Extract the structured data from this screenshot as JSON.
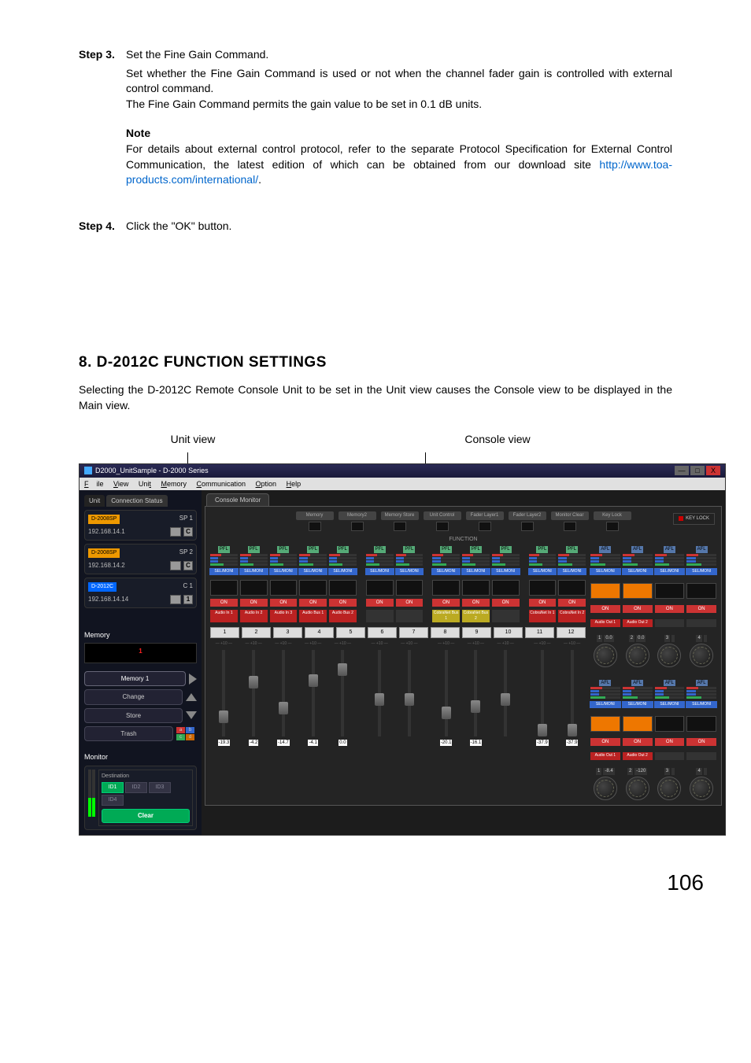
{
  "step3": {
    "label": "Step 3.",
    "headline": "Set the Fine Gain Command.",
    "body1": "Set whether the Fine Gain Command is used or not when the channel fader gain is controlled with external control command.",
    "body2": "The Fine Gain Command permits the gain value to be set in 0.1 dB units."
  },
  "note": {
    "label": "Note",
    "body_pre": "For details about external control protocol, refer to the separate Protocol Specification for External Control Communication, the latest edition of which can be obtained from our download site ",
    "link": "http://www.toa-products.com/international/",
    "body_post": "."
  },
  "step4": {
    "label": "Step 4.",
    "headline": "Click the \"OK\" button."
  },
  "section": {
    "heading": "8. D-2012C FUNCTION SETTINGS",
    "intro": "Selecting the D-2012C Remote Console Unit to be set in the Unit view causes the Console view to be displayed in the Main view.",
    "unit_view": "Unit view",
    "console_view": "Console view"
  },
  "app": {
    "title": "D2000_UnitSample - D-2000 Series",
    "menu": {
      "file": "File",
      "view": "View",
      "unit": "Unit",
      "memory": "Memory",
      "communication": "Communication",
      "option": "Option",
      "help": "Help"
    },
    "win": {
      "min": "—",
      "max": "□",
      "close": "X"
    },
    "left": {
      "tab_unit": "Unit",
      "tab_conn": "Connection Status",
      "units": [
        {
          "id": "D-2008SP",
          "idclass": "o",
          "sp": "SP 1",
          "ip": "192.168.14.1",
          "c": "C"
        },
        {
          "id": "D-2008SP",
          "idclass": "o",
          "sp": "SP 2",
          "ip": "192.168.14.2",
          "c": "C"
        },
        {
          "id": "D-2012C",
          "idclass": "b",
          "sp": "C 1",
          "ip": "192.168.14.14",
          "c": "1"
        }
      ],
      "mem_label": "Memory",
      "mem_num": "1",
      "mem_name": "Memory 1",
      "change": "Change",
      "store": "Store",
      "trash": "Trash",
      "tbtns": [
        "a",
        "b",
        "c",
        "d"
      ],
      "mon_label": "Monitor",
      "dest_label": "Destination",
      "ids": [
        "ID1",
        "ID2",
        "ID3",
        "ID4"
      ],
      "clear": "Clear"
    },
    "right": {
      "tab": "Console Monitor",
      "topboxes": [
        "Memory",
        "Memory2",
        "Memory Store",
        "Unit Control",
        "Fader Layer1",
        "Fader Layer2",
        "Monitor Clear",
        "Key Lock"
      ],
      "func": "FUNCTION",
      "keylock": "KEY LOCK",
      "pfl": "PFL",
      "afl": "AFL",
      "selmoni": "SEL/MONI",
      "on": "ON",
      "audio_in": [
        "Audio In 1",
        "Audio In 2",
        "Audio In 3",
        "Audio Bus 1",
        "Audio Bus 2",
        "",
        "",
        "CobraNet Bus 1",
        "CobraNet Bus 2",
        "",
        "CobraNet In 1",
        "CobraNet In 2"
      ],
      "audio_out": [
        "Audio Out 1",
        "Audio Out 2"
      ],
      "nums": [
        "1",
        "2",
        "3",
        "4",
        "5",
        "6",
        "7",
        "8",
        "9",
        "10",
        "11",
        "12"
      ],
      "knob_r": [
        {
          "n": "1",
          "v": "0.0"
        },
        {
          "n": "2",
          "v": "0.0"
        },
        {
          "n": "3",
          "v": ""
        },
        {
          "n": "4",
          "v": ""
        }
      ],
      "fader_vals": [
        "-19.3",
        "-4.2",
        "-14.7",
        "-4.1",
        "0.0",
        "",
        "",
        "-20.1",
        "-16.1",
        "",
        "-37.9",
        "-37.9"
      ],
      "knob_r2": [
        {
          "n": "1",
          "v": "-8.4"
        },
        {
          "n": "2",
          "v": "-120"
        },
        {
          "n": "3",
          "v": ""
        },
        {
          "n": "4",
          "v": ""
        }
      ],
      "audio_out2": [
        "Audio Out 1",
        "Audio Out 2"
      ]
    }
  },
  "page_number": "106"
}
